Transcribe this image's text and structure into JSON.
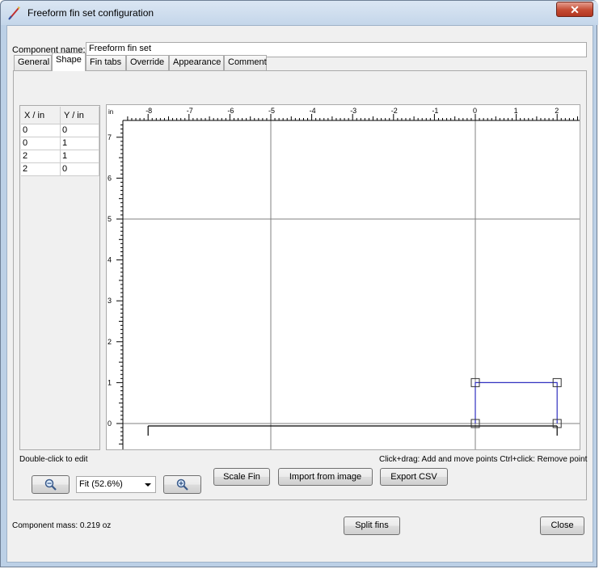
{
  "window": {
    "title": "Freeform fin set configuration",
    "close_glyph": "✕"
  },
  "component": {
    "name_label": "Component name:",
    "name_value": "Freeform fin set"
  },
  "tabs": [
    {
      "label": "General"
    },
    {
      "label": "Shape",
      "selected": true
    },
    {
      "label": "Fin tabs"
    },
    {
      "label": "Override"
    },
    {
      "label": "Appearance"
    },
    {
      "label": "Comment"
    }
  ],
  "points_table": {
    "columns": [
      "X / in",
      "Y / in"
    ],
    "rows": [
      [
        "0",
        "0"
      ],
      [
        "0",
        "1"
      ],
      [
        "2",
        "1"
      ],
      [
        "2",
        "0"
      ]
    ]
  },
  "plot": {
    "unit_label": "in",
    "x_ticks": [
      "-8",
      "-7",
      "-6",
      "-5",
      "-4",
      "-3",
      "-2",
      "-1",
      "0",
      "1",
      "2"
    ],
    "y_ticks": [
      "7",
      "6",
      "5",
      "4",
      "3",
      "2",
      "1",
      "0"
    ],
    "fin_points": [
      [
        0,
        0
      ],
      [
        0,
        1
      ],
      [
        2,
        1
      ],
      [
        2,
        0
      ]
    ],
    "body_line": {
      "x_start": -8,
      "x_end": 2,
      "y": 0
    },
    "fin_color": "#3030c0"
  },
  "hints": {
    "double_click": "Double-click to edit",
    "click_drag": "Click+drag: Add and move points  Ctrl+click: Remove point"
  },
  "zoom": {
    "value": "Fit (52.6%)",
    "zoom_out_icon": "magnifier-minus-icon",
    "zoom_in_icon": "magnifier-plus-icon"
  },
  "buttons": {
    "scale_fin": "Scale Fin",
    "import_image": "Import from image",
    "export_csv": "Export CSV",
    "split_fins": "Split fins",
    "close": "Close"
  },
  "mass": {
    "label": "Component mass: 0.219 oz"
  }
}
